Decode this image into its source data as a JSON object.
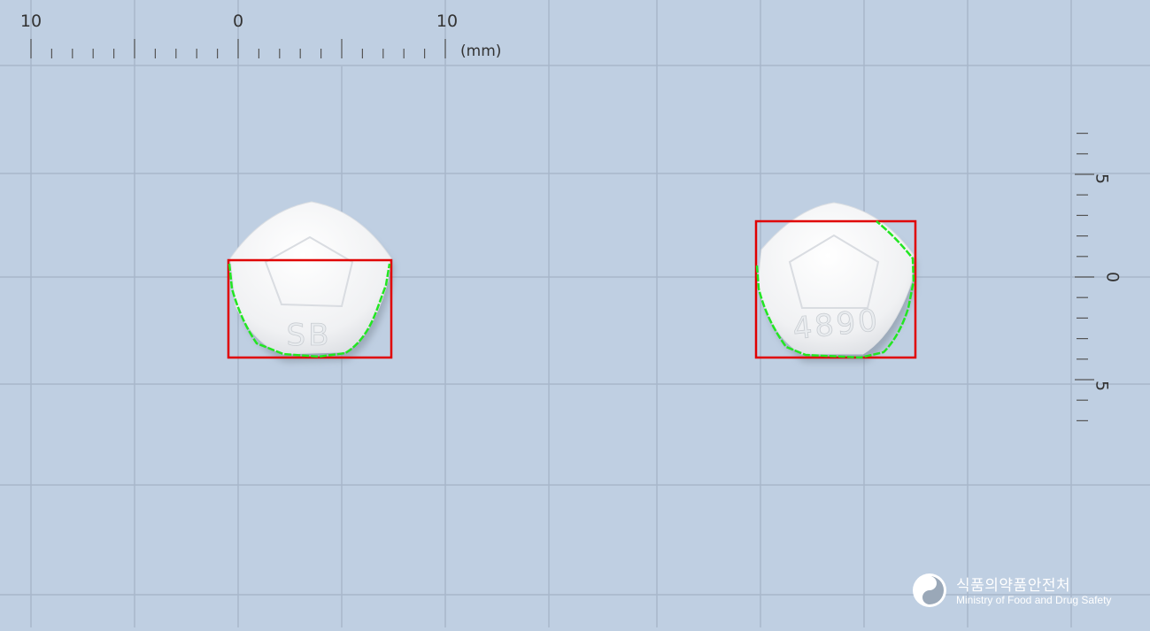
{
  "ruler_top": {
    "labels": [
      "10",
      "0",
      "10"
    ],
    "unit": "(mm)"
  },
  "ruler_right": {
    "labels": [
      "5",
      "0",
      "5"
    ]
  },
  "pills": [
    {
      "name": "pill-left",
      "imprint": "SB"
    },
    {
      "name": "pill-right",
      "imprint": "4890"
    }
  ],
  "colors": {
    "background": "#bfcfe2",
    "grid": "#a6b4c6",
    "bounding_box": "#e00000",
    "contour": "#22e622",
    "pill": "#f2f3f5"
  },
  "logo": {
    "korean": "식품의약품안전처",
    "english": "Ministry of Food and Drug Safety",
    "icon": "mfds-emblem-icon"
  }
}
